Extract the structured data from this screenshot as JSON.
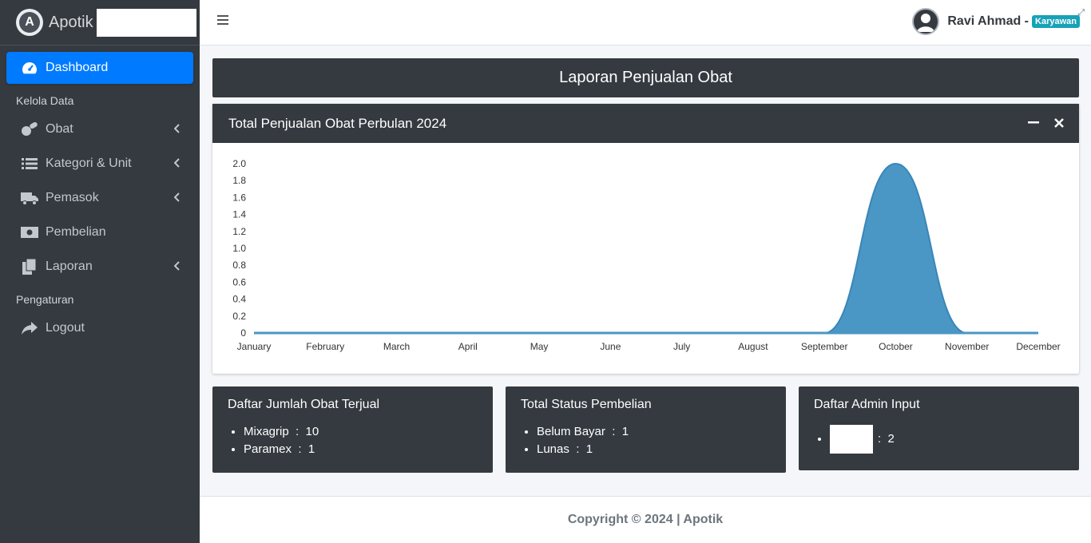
{
  "brand": {
    "name": "Apotik"
  },
  "sidebar": {
    "items": [
      {
        "label": "Dashboard"
      },
      {
        "label": "Obat"
      },
      {
        "label": "Kategori & Unit"
      },
      {
        "label": "Pemasok"
      },
      {
        "label": "Pembelian"
      },
      {
        "label": "Laporan"
      },
      {
        "label": "Logout"
      }
    ],
    "headers": [
      "Kelola Data",
      "Pengaturan"
    ]
  },
  "topbar": {
    "user_name": "Ravi Ahmad -",
    "role_badge": "Karyawan"
  },
  "page": {
    "title": "Laporan Penjualan Obat"
  },
  "chart_card": {
    "title": "Total Penjualan Obat Perbulan 2024"
  },
  "chart_data": {
    "type": "area",
    "categories": [
      "January",
      "February",
      "March",
      "April",
      "May",
      "June",
      "July",
      "August",
      "September",
      "October",
      "November",
      "December"
    ],
    "values": [
      0,
      0,
      0,
      0,
      0,
      0,
      0,
      0,
      0,
      2,
      0,
      0
    ],
    "yticks": [
      "0",
      "0.2",
      "0.4",
      "0.6",
      "0.8",
      "1.0",
      "1.2",
      "1.4",
      "1.6",
      "1.8",
      "2.0"
    ],
    "ylim": [
      0,
      2
    ],
    "color": "#4a96c5",
    "grid": false
  },
  "cards": [
    {
      "title": "Daftar Jumlah Obat Terjual",
      "items": [
        {
          "label": "Mixagrip",
          "sep": ":",
          "value": "10"
        },
        {
          "label": "Paramex",
          "sep": ":",
          "value": "1"
        }
      ]
    },
    {
      "title": "Total Status Pembelian",
      "items": [
        {
          "label": "Belum Bayar",
          "sep": ":",
          "value": "1"
        },
        {
          "label": "Lunas",
          "sep": ":",
          "value": "1"
        }
      ]
    },
    {
      "title": "Daftar Admin Input",
      "items": [
        {
          "sep": ":",
          "value": "2"
        }
      ]
    }
  ],
  "footer": {
    "text": "Copyright © 2024 | Apotik"
  }
}
